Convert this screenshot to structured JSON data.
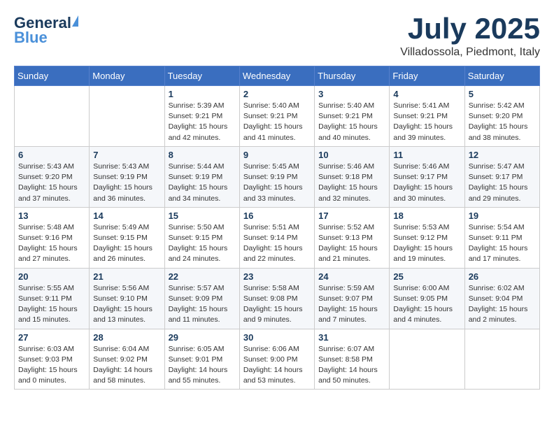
{
  "header": {
    "logo_line1": "General",
    "logo_line2": "Blue",
    "month_title": "July 2025",
    "location": "Villadossola, Piedmont, Italy"
  },
  "days_of_week": [
    "Sunday",
    "Monday",
    "Tuesday",
    "Wednesday",
    "Thursday",
    "Friday",
    "Saturday"
  ],
  "weeks": [
    [
      {
        "day": "",
        "info": ""
      },
      {
        "day": "",
        "info": ""
      },
      {
        "day": "1",
        "info": "Sunrise: 5:39 AM\nSunset: 9:21 PM\nDaylight: 15 hours\nand 42 minutes."
      },
      {
        "day": "2",
        "info": "Sunrise: 5:40 AM\nSunset: 9:21 PM\nDaylight: 15 hours\nand 41 minutes."
      },
      {
        "day": "3",
        "info": "Sunrise: 5:40 AM\nSunset: 9:21 PM\nDaylight: 15 hours\nand 40 minutes."
      },
      {
        "day": "4",
        "info": "Sunrise: 5:41 AM\nSunset: 9:21 PM\nDaylight: 15 hours\nand 39 minutes."
      },
      {
        "day": "5",
        "info": "Sunrise: 5:42 AM\nSunset: 9:20 PM\nDaylight: 15 hours\nand 38 minutes."
      }
    ],
    [
      {
        "day": "6",
        "info": "Sunrise: 5:43 AM\nSunset: 9:20 PM\nDaylight: 15 hours\nand 37 minutes."
      },
      {
        "day": "7",
        "info": "Sunrise: 5:43 AM\nSunset: 9:19 PM\nDaylight: 15 hours\nand 36 minutes."
      },
      {
        "day": "8",
        "info": "Sunrise: 5:44 AM\nSunset: 9:19 PM\nDaylight: 15 hours\nand 34 minutes."
      },
      {
        "day": "9",
        "info": "Sunrise: 5:45 AM\nSunset: 9:19 PM\nDaylight: 15 hours\nand 33 minutes."
      },
      {
        "day": "10",
        "info": "Sunrise: 5:46 AM\nSunset: 9:18 PM\nDaylight: 15 hours\nand 32 minutes."
      },
      {
        "day": "11",
        "info": "Sunrise: 5:46 AM\nSunset: 9:17 PM\nDaylight: 15 hours\nand 30 minutes."
      },
      {
        "day": "12",
        "info": "Sunrise: 5:47 AM\nSunset: 9:17 PM\nDaylight: 15 hours\nand 29 minutes."
      }
    ],
    [
      {
        "day": "13",
        "info": "Sunrise: 5:48 AM\nSunset: 9:16 PM\nDaylight: 15 hours\nand 27 minutes."
      },
      {
        "day": "14",
        "info": "Sunrise: 5:49 AM\nSunset: 9:15 PM\nDaylight: 15 hours\nand 26 minutes."
      },
      {
        "day": "15",
        "info": "Sunrise: 5:50 AM\nSunset: 9:15 PM\nDaylight: 15 hours\nand 24 minutes."
      },
      {
        "day": "16",
        "info": "Sunrise: 5:51 AM\nSunset: 9:14 PM\nDaylight: 15 hours\nand 22 minutes."
      },
      {
        "day": "17",
        "info": "Sunrise: 5:52 AM\nSunset: 9:13 PM\nDaylight: 15 hours\nand 21 minutes."
      },
      {
        "day": "18",
        "info": "Sunrise: 5:53 AM\nSunset: 9:12 PM\nDaylight: 15 hours\nand 19 minutes."
      },
      {
        "day": "19",
        "info": "Sunrise: 5:54 AM\nSunset: 9:11 PM\nDaylight: 15 hours\nand 17 minutes."
      }
    ],
    [
      {
        "day": "20",
        "info": "Sunrise: 5:55 AM\nSunset: 9:11 PM\nDaylight: 15 hours\nand 15 minutes."
      },
      {
        "day": "21",
        "info": "Sunrise: 5:56 AM\nSunset: 9:10 PM\nDaylight: 15 hours\nand 13 minutes."
      },
      {
        "day": "22",
        "info": "Sunrise: 5:57 AM\nSunset: 9:09 PM\nDaylight: 15 hours\nand 11 minutes."
      },
      {
        "day": "23",
        "info": "Sunrise: 5:58 AM\nSunset: 9:08 PM\nDaylight: 15 hours\nand 9 minutes."
      },
      {
        "day": "24",
        "info": "Sunrise: 5:59 AM\nSunset: 9:07 PM\nDaylight: 15 hours\nand 7 minutes."
      },
      {
        "day": "25",
        "info": "Sunrise: 6:00 AM\nSunset: 9:05 PM\nDaylight: 15 hours\nand 4 minutes."
      },
      {
        "day": "26",
        "info": "Sunrise: 6:02 AM\nSunset: 9:04 PM\nDaylight: 15 hours\nand 2 minutes."
      }
    ],
    [
      {
        "day": "27",
        "info": "Sunrise: 6:03 AM\nSunset: 9:03 PM\nDaylight: 15 hours\nand 0 minutes."
      },
      {
        "day": "28",
        "info": "Sunrise: 6:04 AM\nSunset: 9:02 PM\nDaylight: 14 hours\nand 58 minutes."
      },
      {
        "day": "29",
        "info": "Sunrise: 6:05 AM\nSunset: 9:01 PM\nDaylight: 14 hours\nand 55 minutes."
      },
      {
        "day": "30",
        "info": "Sunrise: 6:06 AM\nSunset: 9:00 PM\nDaylight: 14 hours\nand 53 minutes."
      },
      {
        "day": "31",
        "info": "Sunrise: 6:07 AM\nSunset: 8:58 PM\nDaylight: 14 hours\nand 50 minutes."
      },
      {
        "day": "",
        "info": ""
      },
      {
        "day": "",
        "info": ""
      }
    ]
  ]
}
